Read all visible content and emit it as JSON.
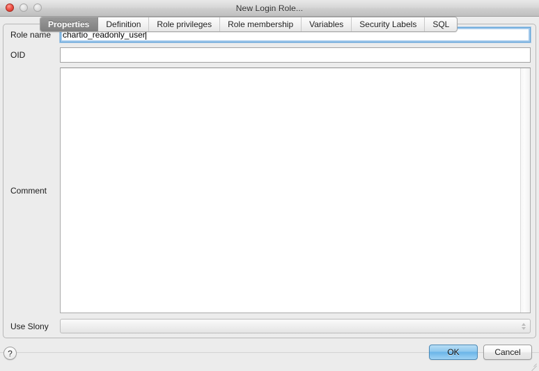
{
  "window": {
    "title": "New Login Role...",
    "traffic_lights": {
      "close": "close-button",
      "minimize": "minimize-button",
      "zoom": "zoom-button"
    }
  },
  "tabs": [
    {
      "label": "Properties",
      "selected": true
    },
    {
      "label": "Definition",
      "selected": false
    },
    {
      "label": "Role privileges",
      "selected": false
    },
    {
      "label": "Role membership",
      "selected": false
    },
    {
      "label": "Variables",
      "selected": false
    },
    {
      "label": "Security Labels",
      "selected": false
    },
    {
      "label": "SQL",
      "selected": false
    }
  ],
  "form": {
    "role_name": {
      "label": "Role name",
      "value": "chartio_readonly_user",
      "placeholder": "",
      "focused": true
    },
    "oid": {
      "label": "OID",
      "value": "",
      "placeholder": ""
    },
    "comment": {
      "label": "Comment",
      "value": "",
      "placeholder": ""
    },
    "use_slony": {
      "label": "Use Slony",
      "value": "",
      "placeholder": "",
      "enabled": false
    }
  },
  "bottom": {
    "help_label": "?",
    "ok_label": "OK",
    "cancel_label": "Cancel"
  },
  "colors": {
    "window_bg": "#ececec",
    "selected_tab_bg": "#8c8c8c",
    "default_button": "#6ab5e8",
    "focus_ring": "#62a6d8"
  }
}
